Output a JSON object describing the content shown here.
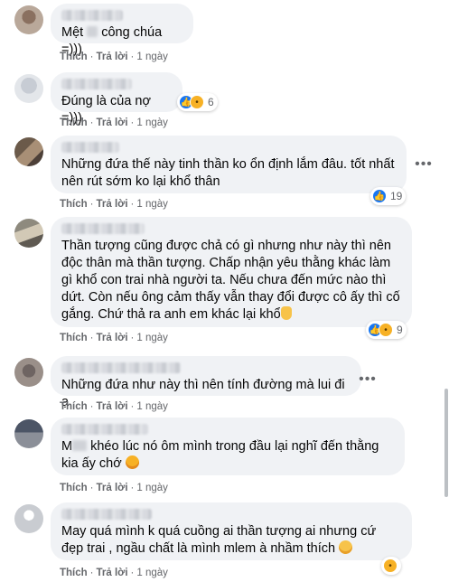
{
  "actions": {
    "like": "Thích",
    "reply": "Trả lời",
    "sep": "·"
  },
  "comments": [
    {
      "text_a": "Mệt ",
      "text_b": " công chúa =)))",
      "time": "1 ngày"
    },
    {
      "text": "Đúng là của nợ =)))",
      "time": "1 ngày",
      "reactions": [
        "like",
        "haha"
      ],
      "reaction_count": "6"
    },
    {
      "text": "Những đứa thế này tinh thần ko ổn định lắm đâu. tốt nhất nên rút sớm ko lại khổ thân",
      "time": "1 ngày",
      "reactions": [
        "like"
      ],
      "reaction_count": "19"
    },
    {
      "text": "Thần tượng cũng được chả có gì nhưng như này thì nên độc thân mà thần tượng. Chấp nhận yêu thằng khác làm gì khổ con trai nhà người ta. Nếu chưa đến mức nào thì dứt. Còn nếu ông cảm thấy vẫn thay đổi được cô ấy thì cố gắng. Chứ thả ra anh em khác lại khổ",
      "time": "1 ngày",
      "emoji": "thumbs-up-icon",
      "reactions": [
        "like",
        "haha"
      ],
      "reaction_count": "9"
    },
    {
      "text": "Những đứa như này thì nên tính đường mà lui đi ạ",
      "time": "1 ngày"
    },
    {
      "text_a": "M",
      "text_b": " khéo lúc nó ôm mình trong đầu lại nghĩ đến thằng kia ấy chớ",
      "time": "1 ngày",
      "emoji": "dizzy-face-icon"
    },
    {
      "text": "May quá mình k quá cuồng ai thần tượng ai nhưng cứ đẹp trai , ngầu chất là mình mlem à nhầm thích",
      "time": "1 ngày",
      "emoji": "sweat-smile-icon",
      "reactions": [
        "haha"
      ]
    }
  ],
  "colors": {
    "bubble": "#f0f2f5",
    "meta": "#65676b",
    "like": "#1877f2",
    "haha": "#f7b125"
  }
}
